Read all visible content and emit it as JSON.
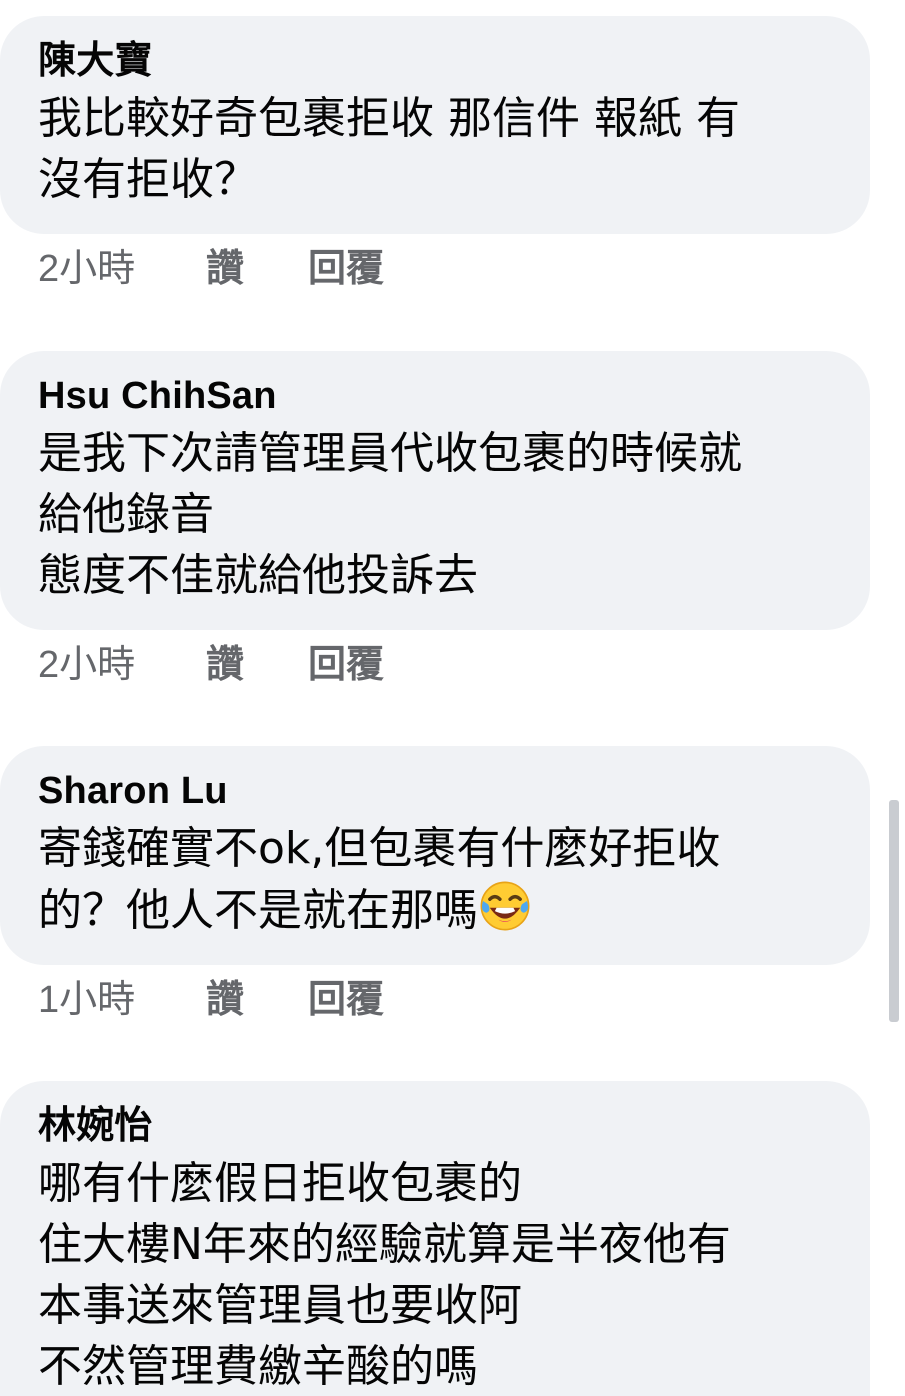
{
  "comments": [
    {
      "author": "陳大寶",
      "text": "我比較好奇包裹拒收 那信件 報紙 有\n沒有拒收？",
      "time": "2小時",
      "like_label": "讚",
      "reply_label": "回覆"
    },
    {
      "author": "Hsu ChihSan",
      "text": "是我下次請管理員代收包裹的時候就\n給他錄音\n態度不佳就給他投訴去",
      "time": "2小時",
      "like_label": "讚",
      "reply_label": "回覆"
    },
    {
      "author": "Sharon Lu",
      "text": "寄錢確實不ok,但包裹有什麼好拒收\n的？他人不是就在那嗎",
      "emoji": "face-with-tears-of-joy-icon",
      "time": "1小時",
      "like_label": "讚",
      "reply_label": "回覆"
    },
    {
      "author": "林婉怡",
      "text": "哪有什麼假日拒收包裹的\n住大樓N年來的經驗就算是半夜他有\n本事送來管理員也要收阿\n不然管理費繳辛酸的嗎"
    }
  ],
  "colors": {
    "bubble": "#f0f2f5",
    "text": "#050505",
    "meta": "#65676b"
  }
}
